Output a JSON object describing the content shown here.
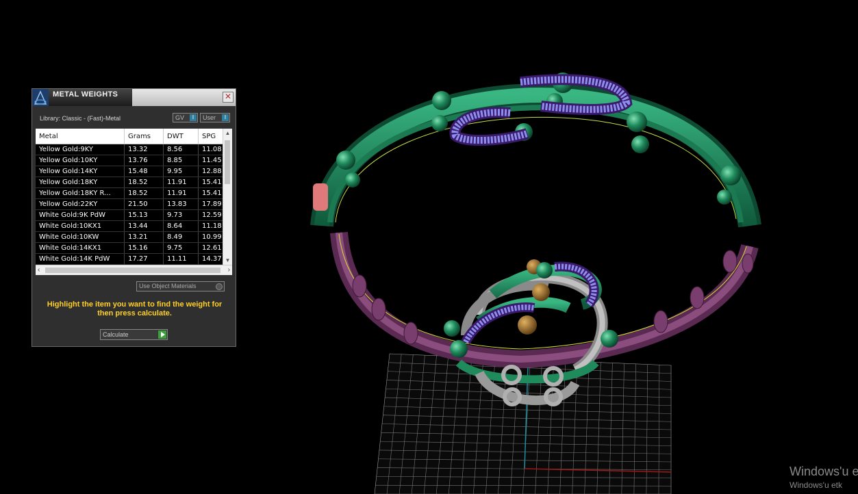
{
  "panel": {
    "title": "METAL WEIGHTS",
    "close_glyph": "✕",
    "library_label": "Library: Classic - (Fast)-Metal",
    "gv_toggle": "GV",
    "user_toggle": "User",
    "toggle_glyph": "I",
    "table": {
      "headers": [
        "Metal",
        "Grams",
        "DWT",
        "SPG"
      ],
      "rows": [
        [
          "Yellow Gold:9KY",
          "13.32",
          "8.56",
          "11.08"
        ],
        [
          "Yellow Gold:10KY",
          "13.76",
          "8.85",
          "11.45"
        ],
        [
          "Yellow Gold:14KY",
          "15.48",
          "9.95",
          "12.88"
        ],
        [
          "Yellow Gold:18KY",
          "18.52",
          "11.91",
          "15.41"
        ],
        [
          "Yellow Gold:18KY R...",
          "18.52",
          "11.91",
          "15.41"
        ],
        [
          "Yellow Gold:22KY",
          "21.50",
          "13.83",
          "17.89"
        ],
        [
          "White Gold:9K PdW",
          "15.13",
          "9.73",
          "12.59"
        ],
        [
          "White Gold:10KX1",
          "13.44",
          "8.64",
          "11.18"
        ],
        [
          "White Gold:10KW",
          "13.21",
          "8.49",
          "10.99"
        ],
        [
          "White Gold:14KX1",
          "15.16",
          "9.75",
          "12.61"
        ],
        [
          "White Gold:14K PdW",
          "17.27",
          "11.11",
          "14.37"
        ]
      ]
    },
    "use_object_materials": "Use Object Materials",
    "instructions": "Highlight the item you want to find the weight for then press calculate.",
    "calculate_label": "Calculate"
  },
  "watermark": {
    "line1": "Windows'u etk",
    "line2": "Windows'u etk"
  },
  "colors": {
    "instructions": "#ffd02a",
    "green_metal": "#1f8a5c",
    "purple_metal": "#7a3e6e",
    "diamond": "#8a8ae8"
  },
  "icons": {
    "app": "rhino-logo-icon",
    "close": "close-icon",
    "calculate": "play-icon"
  }
}
